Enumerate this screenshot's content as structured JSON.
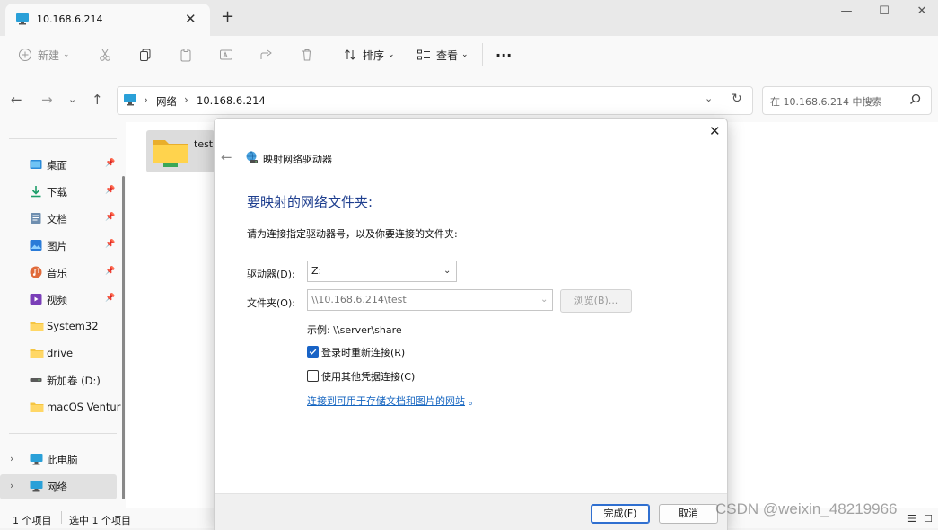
{
  "window": {
    "tab_title": "10.168.6.214",
    "tab_close": "✕",
    "new_tab": "+",
    "minimize": "—",
    "maximize": "☐",
    "close": "✕"
  },
  "toolbar": {
    "new_label": "新建",
    "sort_label": "排序",
    "view_label": "查看",
    "more": "···"
  },
  "address": {
    "segments": [
      "网络",
      "10.168.6.214"
    ],
    "search_placeholder": "在 10.168.6.214 中搜索"
  },
  "sidebar": {
    "quick": [
      {
        "label": "桌面",
        "icon": "desktop-icon",
        "pinned": true
      },
      {
        "label": "下载",
        "icon": "download-icon",
        "pinned": true
      },
      {
        "label": "文档",
        "icon": "documents-icon",
        "pinned": true
      },
      {
        "label": "图片",
        "icon": "pictures-icon",
        "pinned": true
      },
      {
        "label": "音乐",
        "icon": "music-icon",
        "pinned": true
      },
      {
        "label": "视频",
        "icon": "videos-icon",
        "pinned": true
      },
      {
        "label": "System32",
        "icon": "folder-icon",
        "pinned": false
      },
      {
        "label": "drive",
        "icon": "folder-icon",
        "pinned": false
      },
      {
        "label": "新加卷 (D:)",
        "icon": "drive-icon",
        "pinned": false
      },
      {
        "label": "macOS Ventur",
        "icon": "folder-icon",
        "pinned": false
      }
    ],
    "this_pc": "此电脑",
    "network": "网络"
  },
  "content": {
    "items": [
      {
        "label": "test",
        "icon": "shared-folder-icon"
      }
    ]
  },
  "status": {
    "count": "1 个项目",
    "selected": "选中 1 个项目"
  },
  "dialog": {
    "title": "映射网络驱动器",
    "heading": "要映射的网络文件夹:",
    "instruction": "请为连接指定驱动器号，以及你要连接的文件夹:",
    "drive_label": "驱动器(D):",
    "drive_value": "Z:",
    "folder_label": "文件夹(O):",
    "folder_value": "\\\\10.168.6.214\\test",
    "browse_label": "浏览(B)...",
    "example": "示例: \\\\server\\share",
    "reconnect_label": "登录时重新连接(R)",
    "reconnect_checked": true,
    "credentials_label": "使用其他凭据连接(C)",
    "credentials_checked": false,
    "link_text": "连接到可用于存储文档和图片的网站",
    "link_suffix": "。",
    "finish_label": "完成(F)",
    "cancel_label": "取消"
  },
  "watermark": "CSDN @weixin_48219966",
  "colors": {
    "accent": "#1863c6",
    "heading": "#1f3f8f",
    "link": "#1565c0",
    "folder": "#f5c542"
  }
}
